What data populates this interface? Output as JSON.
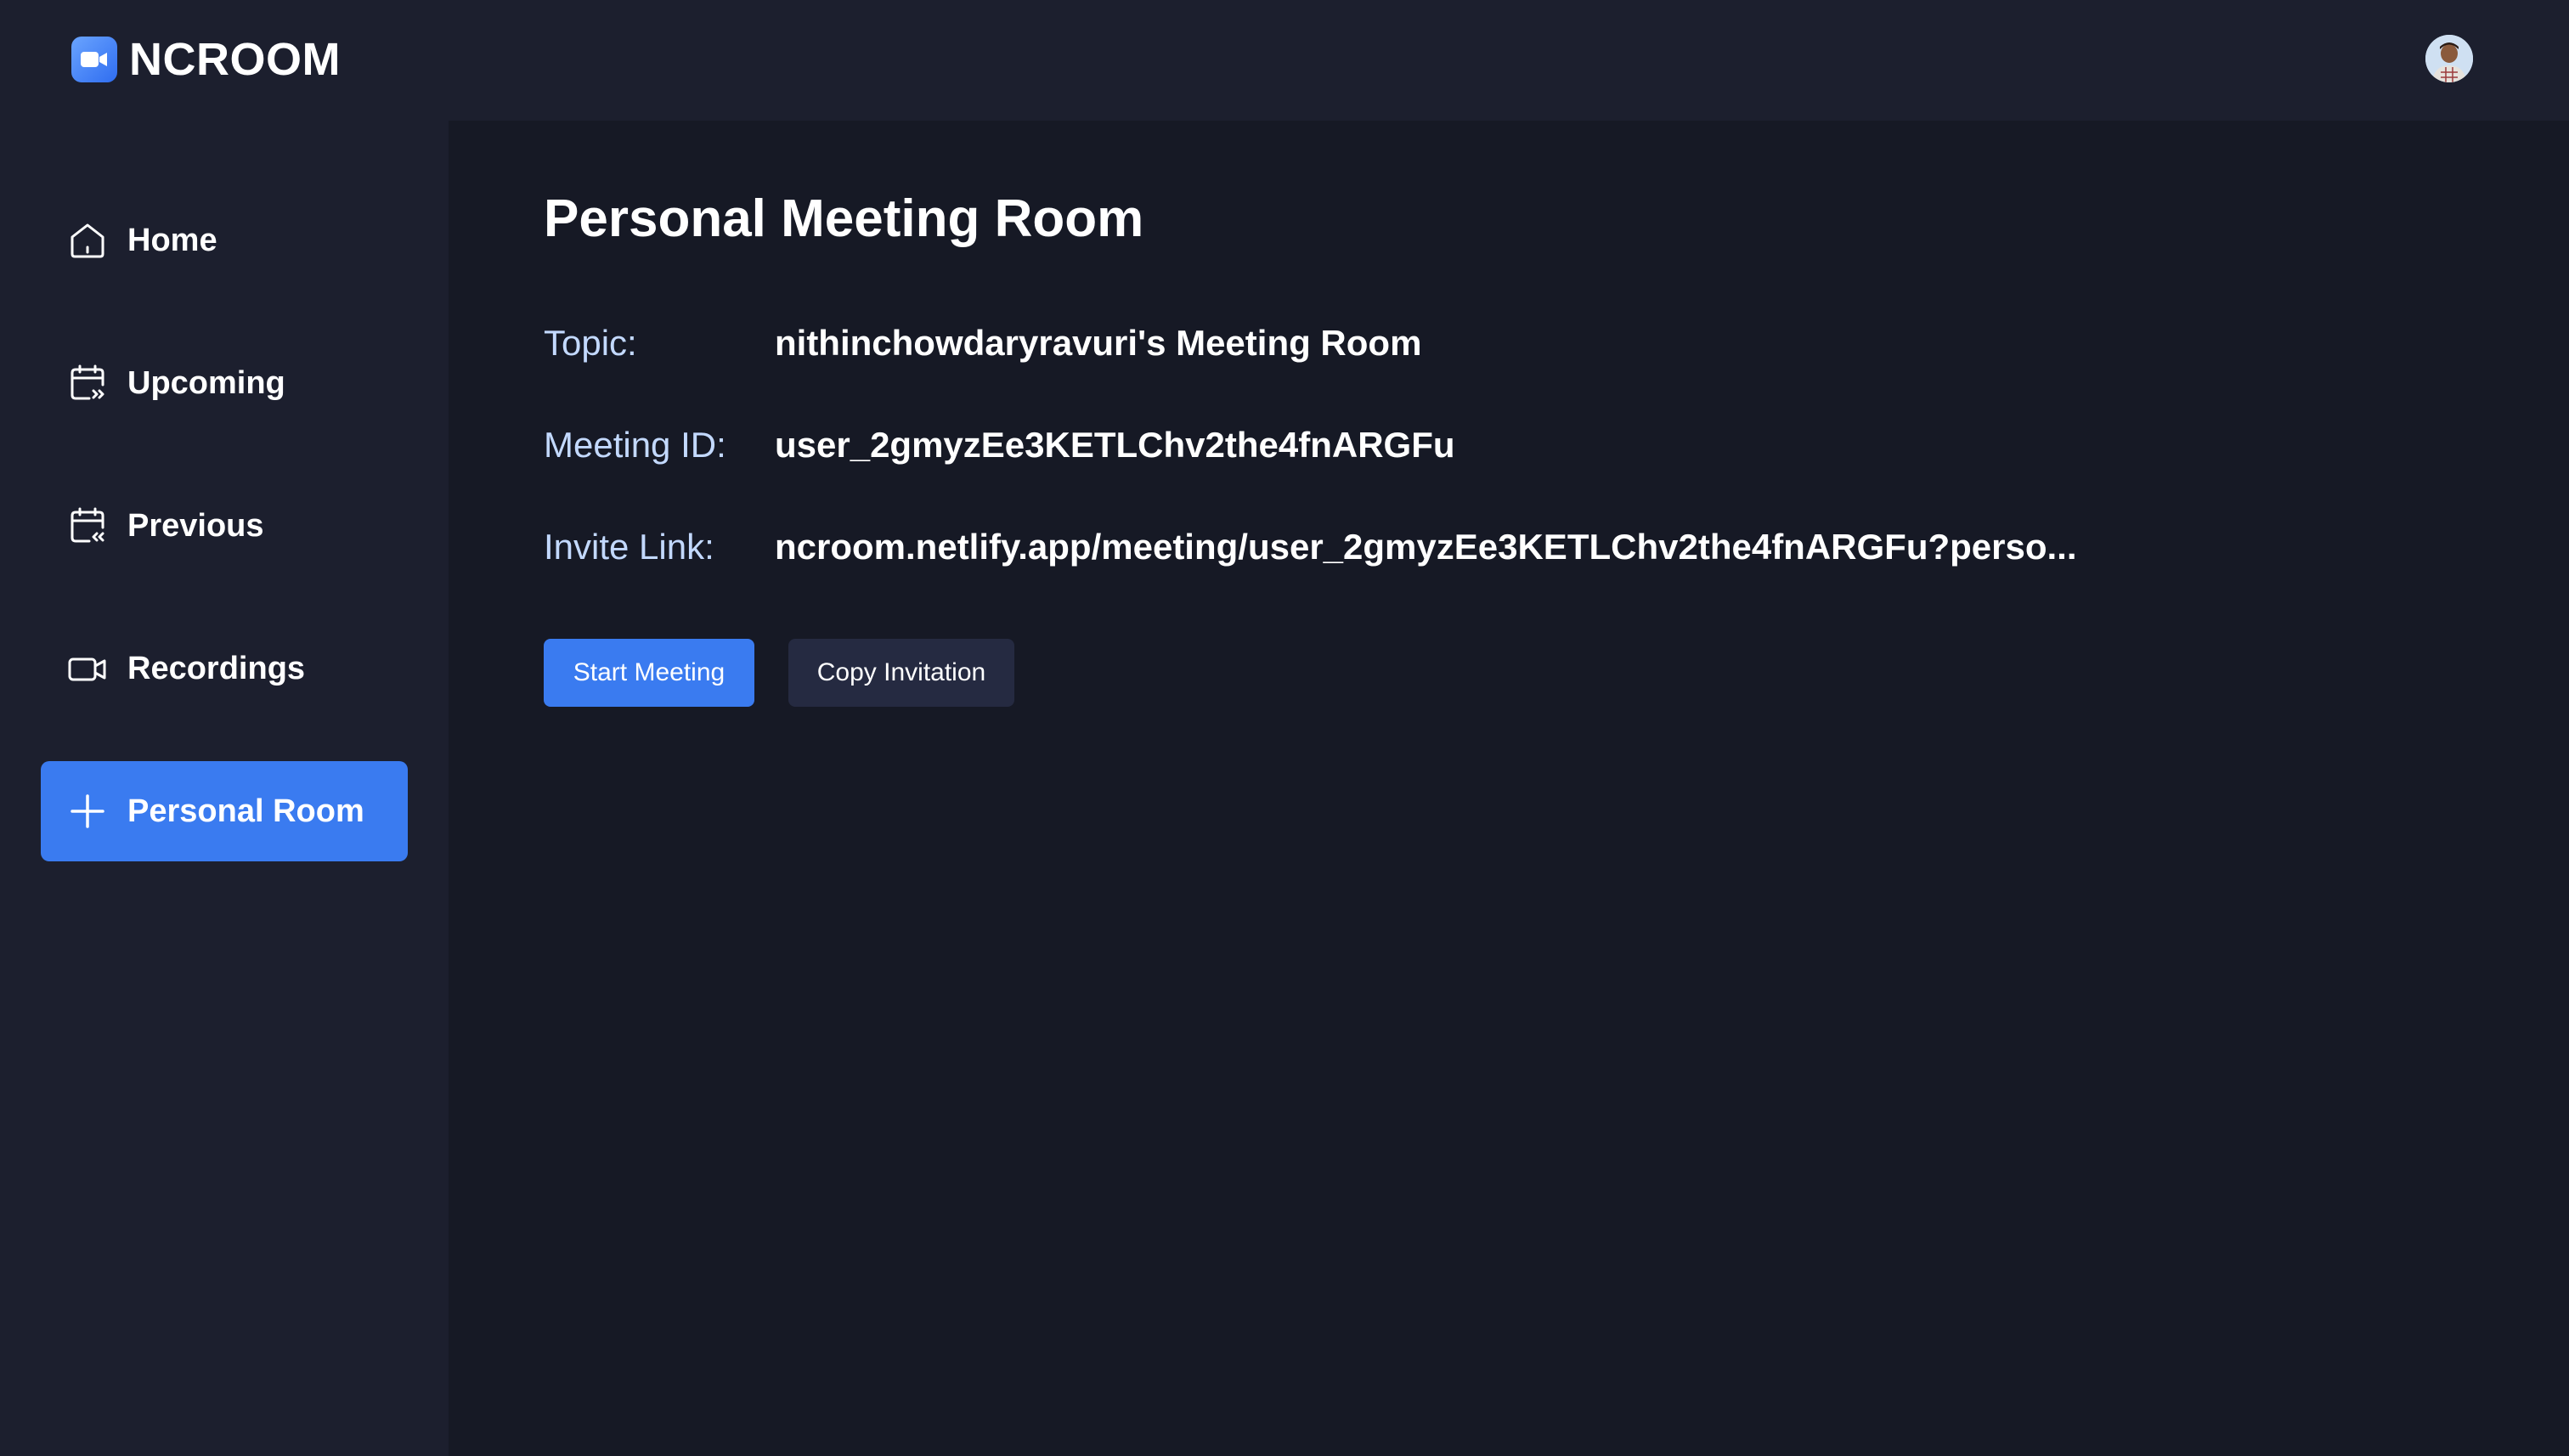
{
  "app": {
    "name": "NCROOM"
  },
  "sidebar": {
    "items": [
      {
        "label": "Home",
        "icon": "home-icon"
      },
      {
        "label": "Upcoming",
        "icon": "calendar-forward-icon"
      },
      {
        "label": "Previous",
        "icon": "calendar-back-icon"
      },
      {
        "label": "Recordings",
        "icon": "video-icon"
      },
      {
        "label": "Personal Room",
        "icon": "plus-icon",
        "active": true
      }
    ]
  },
  "main": {
    "title": "Personal Meeting Room",
    "rows": [
      {
        "label": "Topic:",
        "value": "nithinchowdaryravuri's Meeting Room"
      },
      {
        "label": "Meeting ID:",
        "value": "user_2gmyzEe3KETLChv2the4fnARGFu"
      },
      {
        "label": "Invite Link:",
        "value": "ncroom.netlify.app/meeting/user_2gmyzEe3KETLChv2the4fnARGFu?perso..."
      }
    ],
    "start_button": "Start Meeting",
    "copy_button": "Copy Invitation"
  },
  "colors": {
    "background": "#161925",
    "panel": "#1c1f2e",
    "accent": "#3a7bf0",
    "secondary_button": "#252a41",
    "label": "#c3d9ff"
  }
}
